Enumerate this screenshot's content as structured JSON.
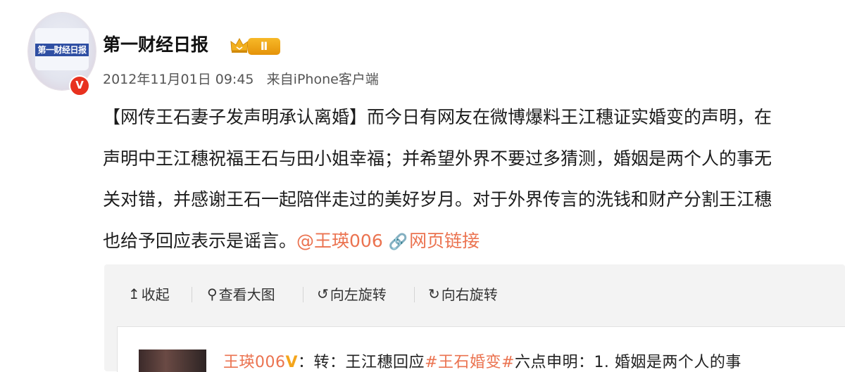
{
  "post": {
    "author": {
      "name": "第一财经日报",
      "avatar_logo_text": "第一财经日报",
      "verified_badge": "V",
      "level_badge": "Ⅱ",
      "crown_icon": "crown-icon"
    },
    "time": "2012年11月01日 09:45",
    "source_prefix": "来自",
    "source_client": "iPhone客户端",
    "content": {
      "line1": "【网传王石妻子发声明承认离婚】而今日有网友在微博爆料王江穗证实婚变的声明，在",
      "line2": "声明中王江穗祝福王石与田小姐幸福；并希望外界不要过多猜测，婚姻是两个人的事无",
      "line3": "关对错，并感谢王石一起陪伴走过的美好岁月。对于外界传言的洗钱和财产分割王江穗",
      "line4_text": "也给予回应表示是谣言。",
      "mention": "@王瑛006",
      "link_icon": "link-icon",
      "link_label": "网页链接"
    },
    "media_toolbar": {
      "collapse": "收起",
      "view_large": "查看大图",
      "rotate_left": "向左旋转",
      "rotate_right": "向右旋转"
    },
    "retweet": {
      "user": "王瑛006",
      "v_badge": "V",
      "separator": "：",
      "text_prefix": "转：王江穗回应",
      "hashtag": "#王石婚变#",
      "text_suffix": "六点申明：1. 婚姻是两个人的事"
    }
  },
  "colors": {
    "link_orange": "#eb7350",
    "verified_red": "#e8311f",
    "level_gold": "#f7b928",
    "toolbar_bg": "#f3f3f3"
  }
}
